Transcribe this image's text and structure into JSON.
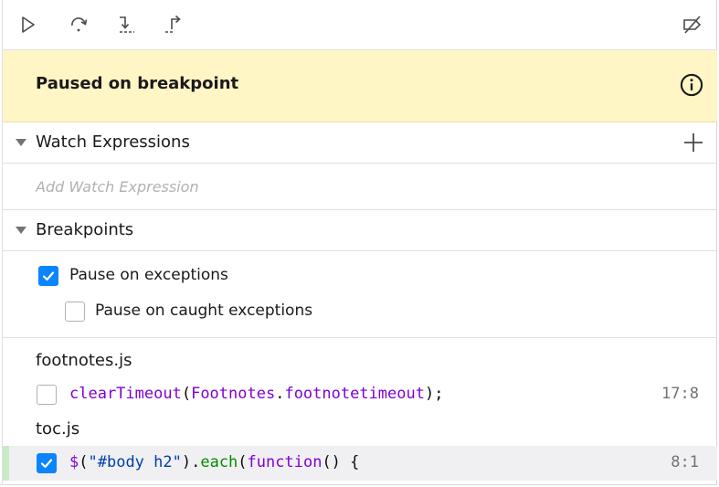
{
  "toolbar": {
    "buttons": [
      {
        "name": "resume-icon"
      },
      {
        "name": "step-over-icon"
      },
      {
        "name": "step-in-icon"
      },
      {
        "name": "step-out-icon"
      },
      {
        "name": "deactivate-breakpoints-icon"
      }
    ]
  },
  "paused": {
    "message": "Paused on breakpoint",
    "icon": "info-icon",
    "background": "#fff5c5"
  },
  "watch": {
    "title": "Watch Expressions",
    "placeholder": "Add Watch Expression",
    "add_icon": "plus-icon"
  },
  "breakpoints": {
    "title": "Breakpoints",
    "pause_on_exceptions": {
      "label": "Pause on exceptions",
      "checked": true
    },
    "pause_on_caught": {
      "label": "Pause on caught exceptions",
      "checked": false
    },
    "files": [
      {
        "name": "footnotes.js",
        "items": [
          {
            "checked": false,
            "code": {
              "fn": "clearTimeout",
              "open": "(",
              "obj": "Footnotes",
              "dot": ".",
              "prop": "footnotetimeout",
              "close": ");"
            },
            "location": "17:8"
          }
        ]
      },
      {
        "name": "toc.js",
        "items": [
          {
            "checked": true,
            "code": {
              "dollar": "$",
              "open": "(",
              "str": "\"#body h2\"",
              "close": ").",
              "method": "each",
              "paren": "(",
              "kw": "function",
              "rest": "() {"
            },
            "location": "8:1"
          }
        ]
      }
    ]
  },
  "colors": {
    "accent": "#0a84ff",
    "keyword": "#8000d7",
    "string": "#003eaa",
    "method": "#058b00",
    "highlight_marker": "#c7ecc6"
  }
}
